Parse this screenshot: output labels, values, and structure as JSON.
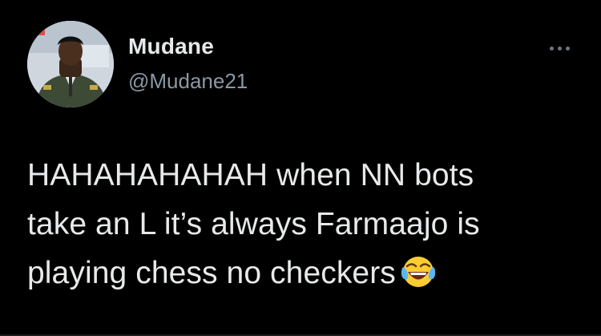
{
  "tweet": {
    "author": {
      "display_name": "Mudane",
      "handle": "@Mudane21"
    },
    "text_lines": [
      "HAHAHAHAHAH when NN bots",
      "take an L it’s always Farmaajo is",
      "playing chess no checkers"
    ],
    "emoji": "face-with-tears-of-joy",
    "more_icon": "more-horizontal-icon"
  },
  "colors": {
    "background": "#000000",
    "primary_text": "#e7e9ea",
    "secondary_text": "#8b98a5"
  }
}
